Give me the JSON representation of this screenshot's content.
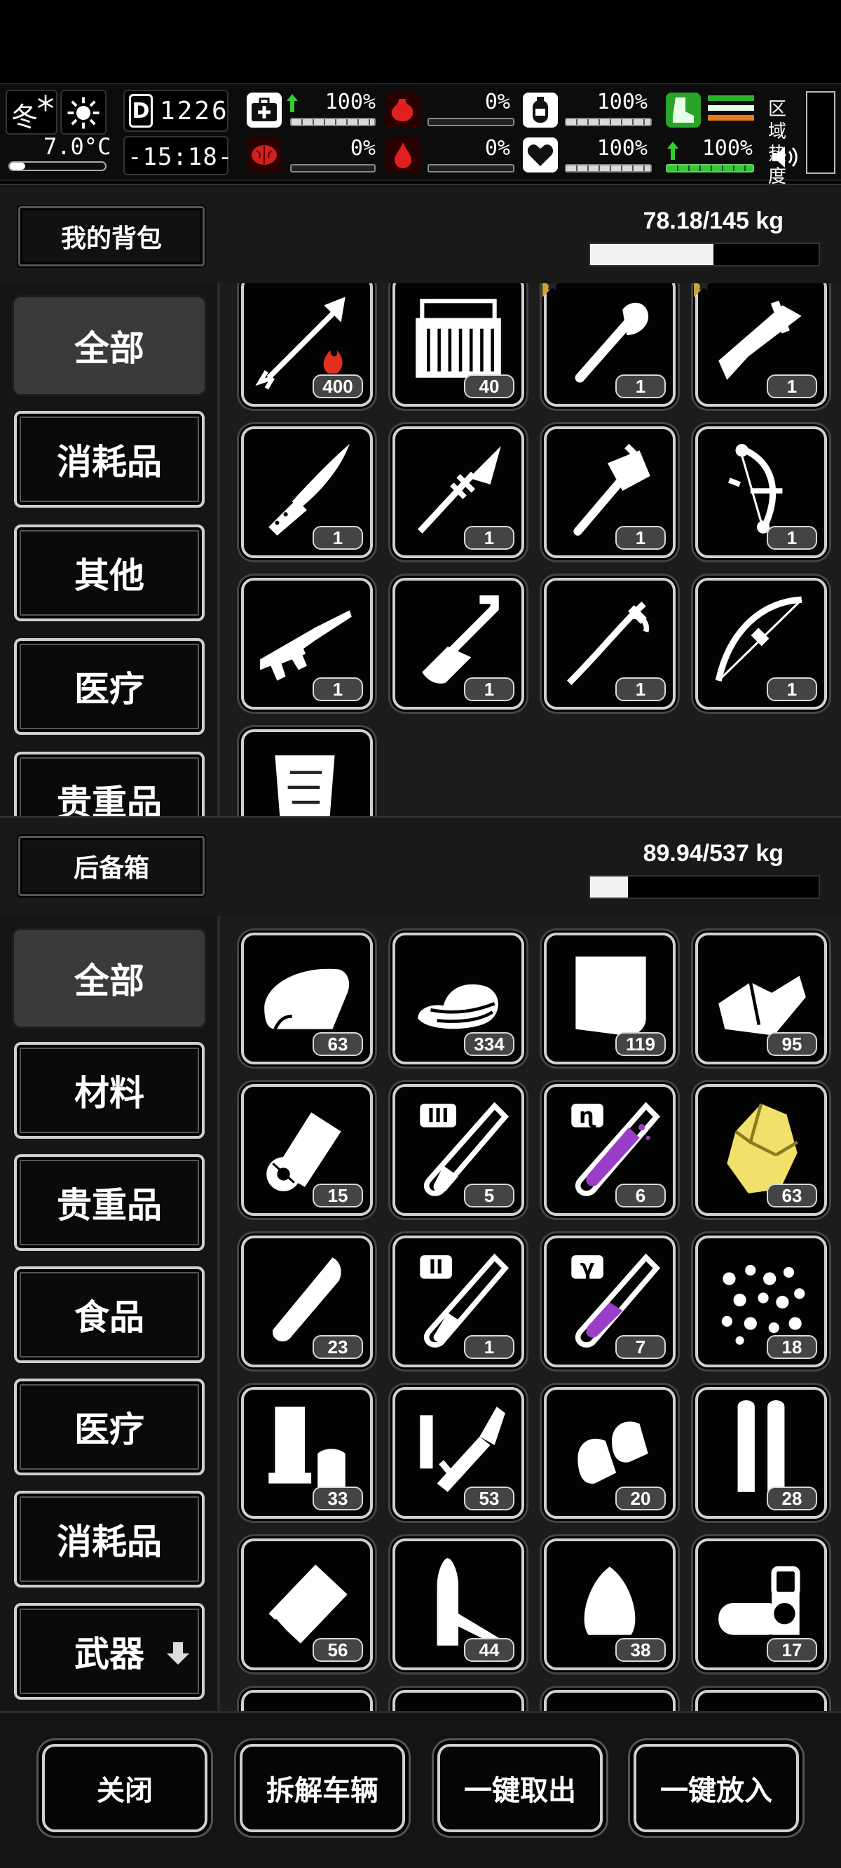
{
  "status": {
    "season": "冬",
    "temperature": "7.0°C",
    "day_counter": "1226",
    "clock": "-15:18-",
    "stats_top": [
      {
        "name": "health",
        "value": "100%",
        "fill": 1.0
      },
      {
        "name": "hunger",
        "value": "0%",
        "fill": 0.0
      },
      {
        "name": "oxygen",
        "value": "100%",
        "fill": 1.0
      }
    ],
    "stats_bottom": [
      {
        "name": "sanity",
        "value": "0%",
        "fill": 0.0
      },
      {
        "name": "bleeding",
        "value": "0%",
        "fill": 0.0
      },
      {
        "name": "mood",
        "value": "100%",
        "fill": 1.0
      }
    ],
    "stamina": {
      "value": "100%",
      "fill": 1.0
    },
    "zone_label": "区域热度"
  },
  "backpack": {
    "title": "我的背包",
    "weight": "78.18/145 kg",
    "weight_fraction": 0.539,
    "categories": [
      "全部",
      "消耗品",
      "其他",
      "医疗",
      "贵重品"
    ],
    "active_category": 0,
    "items": [
      {
        "icon": "fire-arrow-icon",
        "qty": "400"
      },
      {
        "icon": "arrow-crate-icon",
        "qty": "40"
      },
      {
        "icon": "shovel-icon",
        "qty": "1",
        "starred": true
      },
      {
        "icon": "machete-icon",
        "qty": "1",
        "starred": true
      },
      {
        "icon": "hunting-knife-icon",
        "qty": "1"
      },
      {
        "icon": "spear-icon",
        "qty": "1"
      },
      {
        "icon": "hatchet-icon",
        "qty": "1"
      },
      {
        "icon": "compound-bow-icon",
        "qty": "1"
      },
      {
        "icon": "assault-rifle-icon",
        "qty": "1"
      },
      {
        "icon": "spade-icon",
        "qty": "1"
      },
      {
        "icon": "sabre-icon",
        "qty": "1"
      },
      {
        "icon": "recurve-bow-icon",
        "qty": "1"
      },
      {
        "icon": "map-scroll-icon",
        "qty": ""
      }
    ]
  },
  "trunk": {
    "title": "后备箱",
    "weight": "89.94/537 kg",
    "weight_fraction": 0.167,
    "categories": [
      "全部",
      "材料",
      "贵重品",
      "食品",
      "医疗",
      "消耗品",
      "武器"
    ],
    "active_category": 0,
    "items": [
      {
        "icon": "cloth-icon",
        "qty": "63"
      },
      {
        "icon": "cloth-pile-icon",
        "qty": "334"
      },
      {
        "icon": "fabric-sheet-icon",
        "qty": "119"
      },
      {
        "icon": "folded-rag-icon",
        "qty": "95"
      },
      {
        "icon": "paper-roll-icon",
        "qty": "15"
      },
      {
        "icon": "test-tube-iii-icon",
        "qty": "5"
      },
      {
        "icon": "test-tube-purple-icon",
        "qty": "6"
      },
      {
        "icon": "gold-ore-icon",
        "qty": "63"
      },
      {
        "icon": "bullet-tip-icon",
        "qty": "23"
      },
      {
        "icon": "test-tube-ii-icon",
        "qty": "1"
      },
      {
        "icon": "test-tube-gamma-icon",
        "qty": "7"
      },
      {
        "icon": "pellets-icon",
        "qty": "18"
      },
      {
        "icon": "shell-casing-icon",
        "qty": "33"
      },
      {
        "icon": "flare-gun-ammo-icon",
        "qty": "53"
      },
      {
        "icon": "pistol-rounds-icon",
        "qty": "20"
      },
      {
        "icon": "rifle-cartridge-icon",
        "qty": "28"
      },
      {
        "icon": "metal-sheet-icon",
        "qty": "56"
      },
      {
        "icon": "long-bullet-icon",
        "qty": "44"
      },
      {
        "icon": "bullet-head-icon",
        "qty": "38"
      },
      {
        "icon": "shotgun-shells-icon",
        "qty": "17"
      }
    ]
  },
  "actions": [
    "关闭",
    "拆解车辆",
    "一键取出",
    "一键放入"
  ]
}
